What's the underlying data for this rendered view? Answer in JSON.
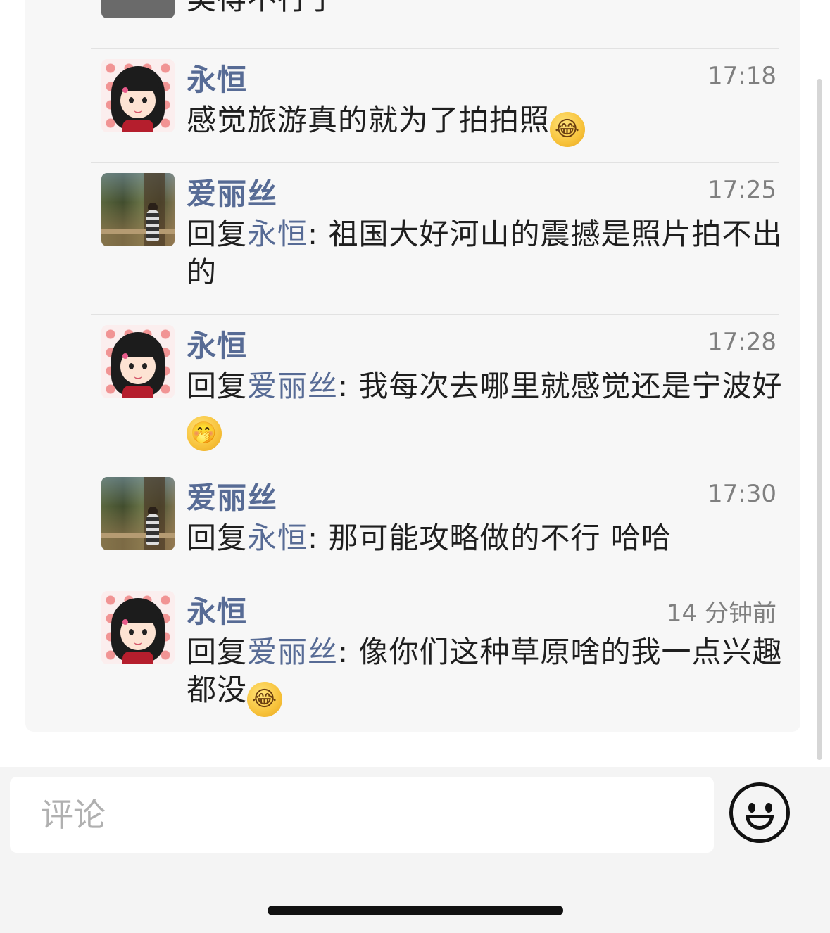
{
  "partial_top": {
    "text": "美得不行了"
  },
  "comments": [
    {
      "author": "永恒",
      "time": "17:18",
      "reply_prefix": "",
      "reply_to": "",
      "text": "感觉旅游真的就为了拍拍照",
      "emoji": "😂"
    },
    {
      "author": "爱丽丝",
      "time": "17:25",
      "reply_prefix": "回复",
      "reply_to": "永恒",
      "text": ": 祖国大好河山的震撼是照片拍不出的",
      "emoji": ""
    },
    {
      "author": "永恒",
      "time": "17:28",
      "reply_prefix": "回复",
      "reply_to": "爱丽丝",
      "text": ": 我每次去哪里就感觉还是宁波好",
      "emoji": "🤭"
    },
    {
      "author": "爱丽丝",
      "time": "17:30",
      "reply_prefix": "回复",
      "reply_to": "永恒",
      "text": ": 那可能攻略做的不行 哈哈",
      "emoji": ""
    },
    {
      "author": "永恒",
      "time": "14 分钟前",
      "reply_prefix": "回复",
      "reply_to": "爱丽丝",
      "text": ": 像你们这种草原啥的我一点兴趣都没",
      "emoji": "😂"
    }
  ],
  "footer": {
    "comment_placeholder": "评论",
    "emoji_button_icon": "smiley-face-icon"
  },
  "colors": {
    "name": "#576b95",
    "panel": "#f7f7f7",
    "time": "#7f7f7f"
  }
}
